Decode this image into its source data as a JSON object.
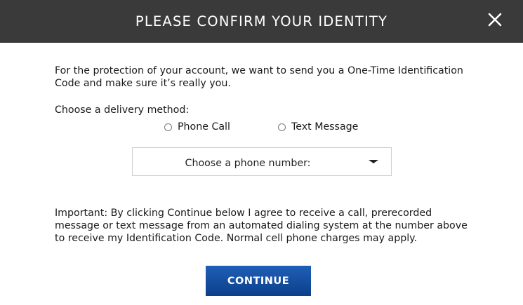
{
  "header": {
    "title": "PLEASE CONFIRM YOUR IDENTITY",
    "close_icon": "close-icon"
  },
  "body": {
    "intro": "For the protection of your account, we want to send you a One-Time Identification Code and make sure it’s really you.",
    "delivery_label": "Choose a delivery method:",
    "options": [
      {
        "label": "Phone Call",
        "selected": false
      },
      {
        "label": "Text Message",
        "selected": false
      }
    ],
    "phone_select": {
      "value": "Choose a phone number:"
    },
    "important_text": "Important: By clicking Continue below I agree to receive a call, prerecorded message or text message from an automated dialing system at the number above to receive my Identification Code. Normal cell phone charges may apply."
  },
  "actions": {
    "continue_label": "CONTINUE"
  },
  "colors": {
    "header_bg": "#3a3a3a",
    "button_bg": "#1f5fb7"
  }
}
